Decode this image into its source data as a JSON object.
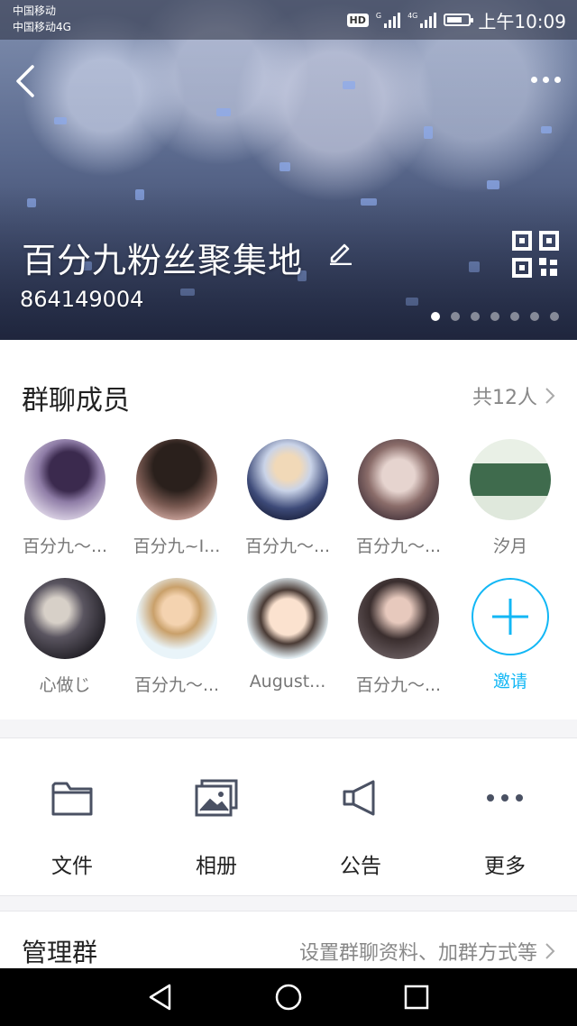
{
  "status_bar": {
    "carrier1": "中国移动",
    "carrier2": "中国移动4G",
    "hd": "HD",
    "network": "4G",
    "time": "上午10:09"
  },
  "header": {
    "group_name": "百分九粉丝聚集地",
    "group_id": "864149004",
    "banner_pages": 7,
    "active_page": 1
  },
  "members": {
    "title": "群聊成员",
    "count": "共12人",
    "list": [
      {
        "name": "百分九～...",
        "bg": "#c9b7d6"
      },
      {
        "name": "百分九~I...",
        "bg": "#6b4e45"
      },
      {
        "name": "百分九～...",
        "bg": "#3f4b6e"
      },
      {
        "name": "百分九～...",
        "bg": "#7a6a6a"
      },
      {
        "name": "汐月",
        "bg": "#b7cfb0"
      },
      {
        "name": "心做じ",
        "bg": "#4d4d52"
      },
      {
        "name": "百分九～...",
        "bg": "#e8f0d8"
      },
      {
        "name": "August...",
        "bg": "#e3eef3"
      },
      {
        "name": "百分九～...",
        "bg": "#3a2e2e"
      }
    ],
    "invite_label": "邀请"
  },
  "actions": [
    {
      "label": "文件",
      "icon": "folder-icon"
    },
    {
      "label": "相册",
      "icon": "album-icon"
    },
    {
      "label": "公告",
      "icon": "announcement-icon"
    },
    {
      "label": "更多",
      "icon": "more-icon"
    }
  ],
  "manage": {
    "title": "管理群",
    "description": "设置群聊资料、加群方式等"
  },
  "colors": {
    "accent": "#12b7f5",
    "icon_gray": "#4a5163"
  }
}
